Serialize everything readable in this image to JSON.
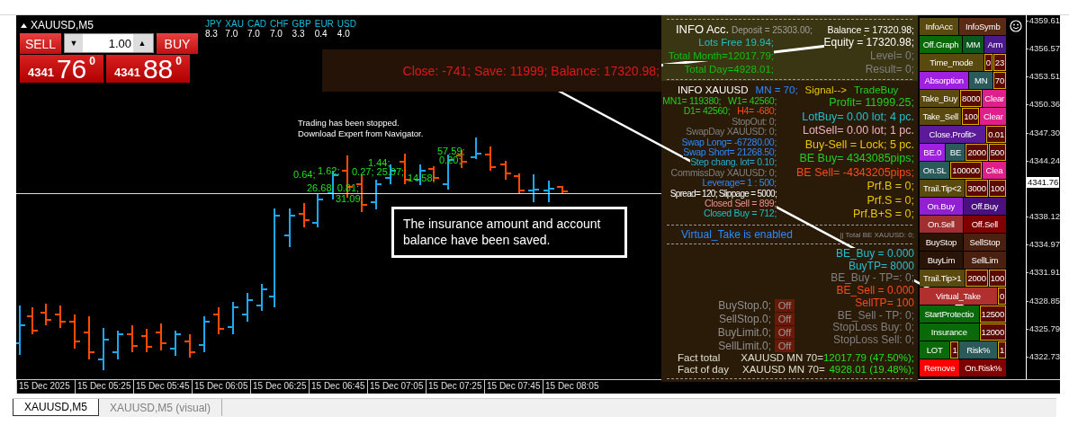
{
  "chart": {
    "symbol": "XAUUSD,M5",
    "currency_strength": [
      {
        "currency": "JPY",
        "value": "8.3"
      },
      {
        "currency": "XAU",
        "value": "7.0"
      },
      {
        "currency": "CAD",
        "value": "7.0"
      },
      {
        "currency": "CHF",
        "value": "7.0"
      },
      {
        "currency": "GBP",
        "value": "3.3"
      },
      {
        "currency": "EUR",
        "value": "0.4"
      },
      {
        "currency": "USD",
        "value": "4.0"
      }
    ],
    "trade_panel": {
      "sell_label": "SELL",
      "buy_label": "BUY",
      "lot": "1.00",
      "down_arrow": "▼",
      "up_arrow": "▲",
      "sell_price": {
        "prefix": "4341",
        "big": "76",
        "sup": "0"
      },
      "buy_price": {
        "prefix": "4341",
        "big": "88",
        "sup": "0"
      }
    },
    "message_banner": "Close: -741; Save: 11999; Balance: 17320.98;",
    "status_lines": [
      "Trading has been stopped.",
      "Download  Expert from  Navigator."
    ],
    "bar_labels": [
      "0.64;",
      "1.62;",
      "26.68; 0.81;",
      "31.09;",
      "0.27; 25.07;",
      "1.44;",
      "14.58;",
      "57.59;",
      "0.20;"
    ],
    "notice": "The insurance amount and account balance have been saved.",
    "price_axis": [
      "4359.61",
      "4356.57",
      "4353.51",
      "4350.36",
      "4347.30",
      "4344.24",
      "4338.12",
      "4334.97",
      "4331.91",
      "4328.85",
      "4325.79",
      "4322.73"
    ],
    "current_price": "4341.76",
    "time_axis": [
      "15 Dec 2025",
      "15 Dec 05:25",
      "15 Dec 05:45",
      "15 Dec 06:05",
      "15 Dec 06:25",
      "15 Dec 06:45",
      "15 Dec 07:05",
      "15 Dec 07:25",
      "15 Dec 07:45",
      "15 Dec 08:05"
    ]
  },
  "info_panel": {
    "account": {
      "title": {
        "text": "INFO Acc.",
        "color": "#ffffff"
      },
      "deposit": {
        "text": "Deposit = 25303.00;",
        "color": "#a0a0a0"
      },
      "left": [
        {
          "text": "Lots Free 19.94;",
          "color": "#20c0c0"
        },
        {
          "text": "Total Month=12017.79;",
          "color": "#10c010"
        },
        {
          "text": "Total Day=4928.01;",
          "color": "#10c010"
        }
      ],
      "right": [
        {
          "text": "Balance = 17320.98;",
          "color": "#ffffff"
        },
        {
          "text": "Equity = 17320.98;",
          "color": "#ffffff"
        },
        {
          "text": "Level= 0;",
          "color": "#808080"
        },
        {
          "text": "Result= 0;",
          "color": "#808080"
        }
      ]
    },
    "symbol_header": [
      {
        "text": "INFO XAUUSD",
        "color": "#ffffff"
      },
      {
        "text": "MN = 70;",
        "color": "#2a8cff"
      },
      {
        "text": "Signal-->",
        "color": "#e8c800"
      },
      {
        "text": "TradeBuy",
        "color": "#20d020"
      }
    ],
    "symbol_left": [
      {
        "kind": "line",
        "items": [
          {
            "text": "MN1= 119380;",
            "color": "#20d020"
          },
          {
            "text": "W1= 42560;",
            "color": "#20d020"
          }
        ]
      },
      {
        "kind": "line",
        "items": [
          {
            "text": "D1= 42560;",
            "color": "#20d020"
          },
          {
            "text": "H4= -680;",
            "color": "#ff4a1a"
          }
        ]
      },
      {
        "kind": "line",
        "items": [
          {
            "text": "StopOut: 0;",
            "color": "#808080"
          }
        ]
      },
      {
        "kind": "line",
        "items": [
          {
            "text": "SwapDay XAUUSD:  0;",
            "color": "#808080"
          }
        ]
      },
      {
        "kind": "line",
        "items": [
          {
            "text": "Swap Long= -67280.00;",
            "color": "#2a8cff"
          }
        ]
      },
      {
        "kind": "line",
        "items": [
          {
            "text": "Swap Short= 21268.50;",
            "color": "#2a8cff"
          }
        ]
      },
      {
        "kind": "line",
        "items": [
          {
            "text": "Step chang. lot= 0.10;",
            "color": "#20b0d0"
          }
        ]
      },
      {
        "kind": "line",
        "items": [
          {
            "text": "CommissDay XAUUSD:  0;",
            "color": "#808080"
          }
        ]
      },
      {
        "kind": "line",
        "items": [
          {
            "text": "Leverage= 1 : 500;",
            "color": "#2a8cff"
          }
        ]
      },
      {
        "kind": "small",
        "items": [
          {
            "text": "Spread= 120; Slippage = 5000;",
            "color": "#ffffff"
          }
        ]
      },
      {
        "kind": "line",
        "items": [
          {
            "text": "Closed  Sell = 899;",
            "color": "#f09090"
          }
        ]
      },
      {
        "kind": "line",
        "items": [
          {
            "text": "Closed Buy = 712;",
            "color": "#20c0c0"
          }
        ]
      }
    ],
    "symbol_right": [
      {
        "text": "Profit= 11999.25;",
        "color": "#20d020"
      },
      {
        "text": "LotBuy= 0.00 lot; 4 pc.",
        "color": "#20c0d0"
      },
      {
        "text": "LotSell= 0.00 lot; 1 pc.",
        "color": "#f0b0c0"
      },
      {
        "text": "Buy-Sell = Lock; 5 pc.",
        "color": "#e8c800"
      },
      {
        "text": "BE Buy= 4343085pips;",
        "color": "#20d020"
      },
      {
        "text": "BE Sell= -4343205pips;",
        "color": "#ff4a1a"
      },
      {
        "text": "Prf.B = 0;",
        "color": "#e8c800"
      },
      {
        "text": "Prf.S = 0;",
        "color": "#e8c800"
      },
      {
        "text": "Prf.B+S = 0;",
        "color": "#e8c800"
      }
    ],
    "virtual_take": {
      "text": "Virtual_Take is enabled",
      "color": "#2a8cff"
    },
    "total_be": "|| Total BE XAUUSD: 0;",
    "be_lines": [
      {
        "text": "BE_Buy = 0.000",
        "color": "#20c0d0"
      },
      {
        "text": "BuyTP= 8000",
        "color": "#20c0d0"
      },
      {
        "text": "BE_Buy - TP=: 0;",
        "color": "#808080"
      },
      {
        "text": "BE_Sell = 0.000",
        "color": "#ff4a1a"
      },
      {
        "text": "SellTP= 100",
        "color": "#ff4a1a"
      },
      {
        "text": "BE_Sell - TP: 0;",
        "color": "#808080"
      },
      {
        "text": "StopLoss Buy: 0;",
        "color": "#808080"
      },
      {
        "text": "StopLoss Sell: 0;",
        "color": "#808080"
      }
    ],
    "pending_orders": [
      {
        "label": "BuyStop.0;",
        "toggle": "Off"
      },
      {
        "label": "SellStop.0;",
        "toggle": "Off"
      },
      {
        "label": "BuyLimit.0;",
        "toggle": "Off"
      },
      {
        "label": "SellLimit.0;",
        "toggle": "Off"
      }
    ],
    "fact_rows": [
      {
        "label": "Fact total",
        "symbol": "XAUUSD MN 70=",
        "value": "12017.79 (47.50%);"
      },
      {
        "label": "Fact of day",
        "symbol": "XAUUSD MN 70=",
        "value": "4928.01 (19.48%);"
      }
    ]
  },
  "control_rows": [
    [
      {
        "label": "InfoAcc",
        "kind": "button",
        "color": "#5a4a10"
      },
      {
        "label": "InfoSymb",
        "kind": "button",
        "color": "#5a2a14"
      }
    ],
    [
      {
        "label": "Off.Graph",
        "kind": "button",
        "color": "#0a6a0a"
      },
      {
        "label": "MM",
        "kind": "button",
        "color": "#0a5a20"
      },
      {
        "label": "Arm",
        "kind": "button",
        "color": "#4a1a8a"
      }
    ],
    [
      {
        "label": "Time_mode",
        "kind": "button",
        "color": "#5a4a10"
      },
      {
        "label": "0",
        "kind": "field"
      },
      {
        "label": "23",
        "kind": "field"
      }
    ],
    [
      {
        "label": "Absorption",
        "kind": "button",
        "color": "#a020e0"
      },
      {
        "label": "MN",
        "kind": "button",
        "color": "#2a5a5a"
      },
      {
        "label": "70",
        "kind": "field"
      }
    ],
    [
      {
        "label": "Take_Buy",
        "kind": "button",
        "color": "#5a4a10"
      },
      {
        "label": "8000",
        "kind": "field"
      },
      {
        "label": "Clear",
        "kind": "button",
        "color": "#e0208a"
      }
    ],
    [
      {
        "label": "Take_Sell",
        "kind": "button",
        "color": "#5a4a10"
      },
      {
        "label": "100",
        "kind": "field"
      },
      {
        "label": "Clear",
        "kind": "button",
        "color": "#e0208a"
      }
    ],
    [
      {
        "label": "Close.Profit>",
        "kind": "button",
        "color": "#5a1a9a"
      },
      {
        "label": "0.01",
        "kind": "field"
      }
    ],
    [
      {
        "label": "BE.0",
        "kind": "button",
        "color": "#a020e0"
      },
      {
        "label": "BE",
        "kind": "button",
        "color": "#2a5a5a"
      },
      {
        "label": "2000",
        "kind": "field"
      },
      {
        "label": "500",
        "kind": "field"
      }
    ],
    [
      {
        "label": "On.SL",
        "kind": "button",
        "color": "#2a5a5a"
      },
      {
        "label": "100000",
        "kind": "field"
      },
      {
        "label": "Clea",
        "kind": "button",
        "color": "#e0208a"
      }
    ],
    [
      {
        "label": "Trail.Tip<2",
        "kind": "button",
        "color": "#5a4a10"
      },
      {
        "label": "3000",
        "kind": "field"
      },
      {
        "label": "100",
        "kind": "field"
      }
    ],
    [
      {
        "label": "On.Buy",
        "kind": "button",
        "color": "#9020d0"
      },
      {
        "label": "Off.Buy",
        "kind": "button",
        "color": "#4a1080"
      }
    ],
    [
      {
        "label": "On.Sell",
        "kind": "button",
        "color": "#a03030"
      },
      {
        "label": "Off.Sell",
        "kind": "button",
        "color": "#800000"
      }
    ],
    [
      {
        "label": "BuyStop",
        "kind": "button",
        "color": "#2a1408"
      },
      {
        "label": "SellStop",
        "kind": "button",
        "color": "#4a2010"
      }
    ],
    [
      {
        "label": "BuyLim",
        "kind": "button",
        "color": "#2a1408"
      },
      {
        "label": "SellLim",
        "kind": "button",
        "color": "#4a2010"
      }
    ],
    [
      {
        "label": "Trail.Tip>1",
        "kind": "button",
        "color": "#5a4a10"
      },
      {
        "label": "2000",
        "kind": "field"
      },
      {
        "label": "100",
        "kind": "field"
      }
    ],
    [
      {
        "label": "Virtual_Take",
        "kind": "button",
        "color": "#b03030"
      },
      {
        "label": "0",
        "kind": "field"
      }
    ],
    [
      {
        "label": "StartProtectio",
        "kind": "button",
        "color": "#0a6a0a"
      },
      {
        "label": "12500",
        "kind": "field"
      }
    ],
    [
      {
        "label": "Insurance",
        "kind": "button",
        "color": "#0a6a0a"
      },
      {
        "label": "12000",
        "kind": "field"
      }
    ],
    [
      {
        "label": "LOT",
        "kind": "button",
        "color": "#0a6a0a"
      },
      {
        "label": "1",
        "kind": "field"
      },
      {
        "label": "Risk%",
        "kind": "button",
        "color": "#2a5a5a"
      },
      {
        "label": "1",
        "kind": "field"
      }
    ],
    [
      {
        "label": "Remove",
        "kind": "button",
        "color": "#ff0000"
      },
      {
        "label": "On.Risk%",
        "kind": "button",
        "color": "#800000"
      }
    ]
  ],
  "tabs": [
    {
      "label": "XAUUSD,M5",
      "selected": true
    },
    {
      "label": "XAUUSD,M5 (visual)",
      "selected": false
    }
  ]
}
